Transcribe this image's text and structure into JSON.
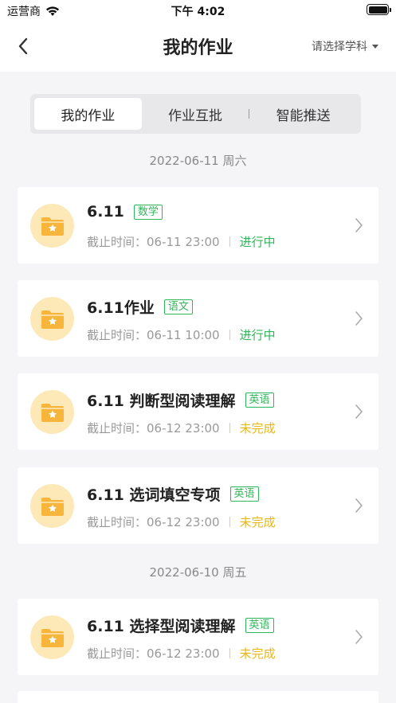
{
  "status_bar": {
    "carrier": "运营商",
    "time": "下午 4:02"
  },
  "nav": {
    "title": "我的作业",
    "subject_picker": "请选择学科"
  },
  "tabs": [
    {
      "label": "我的作业",
      "active": true
    },
    {
      "label": "作业互批",
      "active": false
    },
    {
      "label": "智能推送",
      "active": false
    }
  ],
  "groups": [
    {
      "date": "2022-06-11 周六",
      "items": [
        {
          "title": "6.11",
          "subject": "数学",
          "deadline": "截止时间：06-11 23:00",
          "status": "进行中",
          "status_type": "ongoing"
        },
        {
          "title": "6.11作业",
          "subject": "语文",
          "deadline": "截止时间：06-11 10:00",
          "status": "进行中",
          "status_type": "ongoing"
        },
        {
          "title": "6.11 判断型阅读理解",
          "subject": "英语",
          "deadline": "截止时间：06-12 23:00",
          "status": "未完成",
          "status_type": "pending"
        },
        {
          "title": "6.11 选词填空专项",
          "subject": "英语",
          "deadline": "截止时间：06-12 23:00",
          "status": "未完成",
          "status_type": "pending"
        }
      ]
    },
    {
      "date": "2022-06-10 周五",
      "items": [
        {
          "title": "6.11 选择型阅读理解",
          "subject": "英语",
          "deadline": "截止时间：06-12 23:00",
          "status": "未完成",
          "status_type": "pending"
        }
      ]
    }
  ],
  "colors": {
    "ongoing": "#2fb65a",
    "pending": "#e8b817",
    "icon_bg": "#fde8b8",
    "icon_folder": "#f7b63b"
  }
}
